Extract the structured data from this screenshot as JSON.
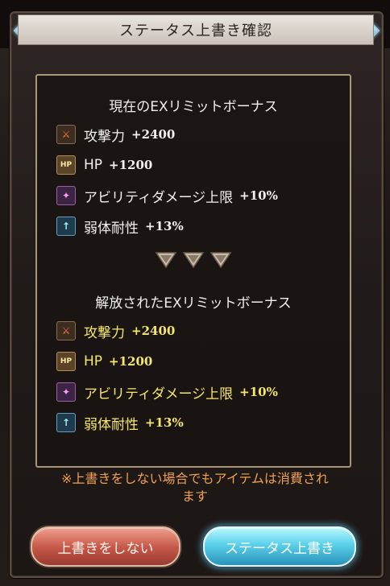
{
  "dialog": {
    "title": "ステータス上書き確認",
    "current_header": "現在のEXリミットボーナス",
    "released_header": "解放されたEXリミットボーナス",
    "current_bonuses": [
      {
        "icon": "attack-icon",
        "label": "攻撃力",
        "value": "+2400"
      },
      {
        "icon": "hp-icon",
        "label": "HP",
        "value": "+1200"
      },
      {
        "icon": "ability-damage-icon",
        "label": "アビリティダメージ上限",
        "value": "+10%"
      },
      {
        "icon": "weakness-resist-icon",
        "label": "弱体耐性",
        "value": "+13%"
      }
    ],
    "released_bonuses": [
      {
        "icon": "attack-icon",
        "label": "攻撃力",
        "value": "+2400"
      },
      {
        "icon": "hp-icon",
        "label": "HP",
        "value": "+1200"
      },
      {
        "icon": "ability-damage-icon",
        "label": "アビリティダメージ上限",
        "value": "+10%"
      },
      {
        "icon": "weakness-resist-icon",
        "label": "弱体耐性",
        "value": "+13%"
      }
    ],
    "note_line1": "※上書きをしない場合でもアイテムは消費され",
    "note_line2": "ます",
    "cancel_label": "上書きをしない",
    "confirm_label": "ステータス上書き"
  },
  "colors": {
    "released_text": "#f6e66a",
    "note_text": "#f0a050",
    "cancel_button": "#c85a4a",
    "confirm_button": "#5ad0ea"
  }
}
